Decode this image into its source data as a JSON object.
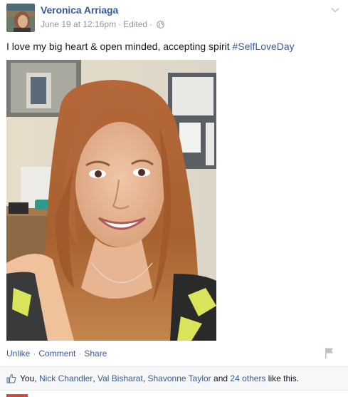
{
  "post": {
    "author": "Veronica Arriaga",
    "date": "June 19 at 12:16pm",
    "separator": "·",
    "edited": "Edited",
    "text_plain": "I love my big heart & open minded, accepting spirit ",
    "hashtag": "#SelfLoveDay",
    "icons": {
      "privacy": "globe-icon",
      "options": "chevron-down-icon",
      "report": "flag-icon",
      "like": "thumbs-up-icon"
    }
  },
  "actions": {
    "unlike": "Unlike",
    "comment": "Comment",
    "share": "Share",
    "dot": "·"
  },
  "likes": {
    "you": "You,",
    "names": [
      "Nick Chandler",
      "Val Bisharat",
      "Shavonne Taylor"
    ],
    "comma": ",",
    "and": "and",
    "others": "24 others",
    "suffix": "like this."
  },
  "colors": {
    "link": "#3b5998",
    "meta": "#9197a3",
    "text": "#141823",
    "likes_bg": "#f6f7f9"
  }
}
